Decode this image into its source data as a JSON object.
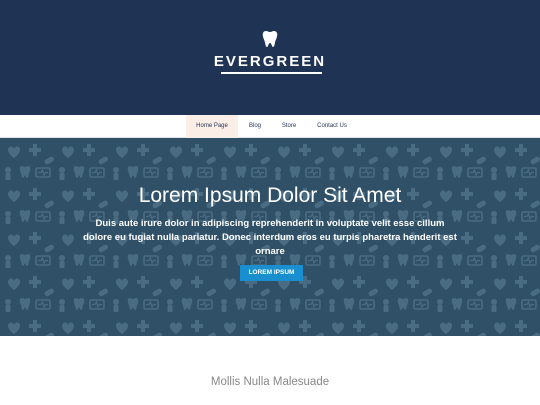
{
  "brand": {
    "name": "EVERGREEN",
    "logo_icon": "tooth-icon"
  },
  "nav": {
    "items": [
      {
        "label": "Home Page",
        "active": true
      },
      {
        "label": "Blog",
        "active": false
      },
      {
        "label": "Store",
        "active": false
      },
      {
        "label": "Contact Us",
        "active": false
      }
    ]
  },
  "hero": {
    "title": "Lorem Ipsum Dolor Sit Amet",
    "text": "Duis aute irure dolor in adipiscing reprehenderit in voluptate velit esse cillum dolore eu fugiat nulla pariatur. Donec interdum eros eu turpis pharetra henderit est ornare",
    "button_label": "LOREM IPSUM",
    "pattern_icons": [
      "heart-icon",
      "cross-icon",
      "pill-icon",
      "tooth-icon",
      "person-icon",
      "star-of-life-icon"
    ]
  },
  "section": {
    "title": "Mollis Nulla Malesuade"
  },
  "colors": {
    "header_bg": "#1f3354",
    "hero_bg": "#2f5066",
    "pattern": "#4a6c82",
    "button": "#1a8fd0",
    "nav_active_bg": "#fbeee6"
  }
}
